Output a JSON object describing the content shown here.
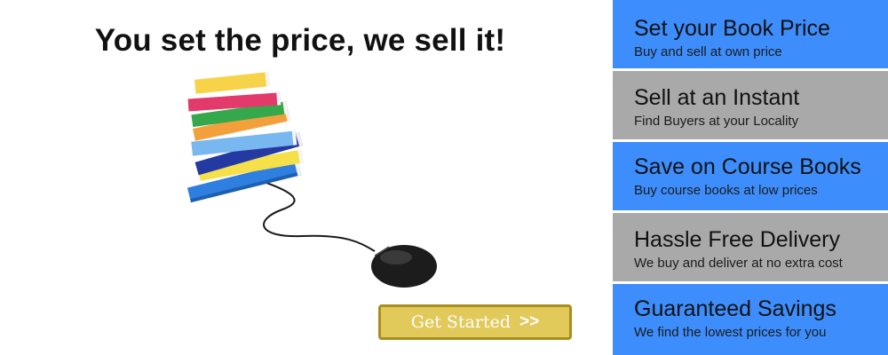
{
  "hero": {
    "headline": "You set the price, we sell it!",
    "cta_label": "Get Started",
    "cta_arrows": ">>"
  },
  "colors": {
    "feature_blue": "#3d8efc",
    "feature_gray": "#a9a9a9",
    "cta_gold": "#e1c95a",
    "cta_border": "#a88e21"
  },
  "features": [
    {
      "title": "Set your Book Price",
      "subtitle": "Buy and sell at own price",
      "color": "#3d8efc"
    },
    {
      "title": "Sell at an Instant",
      "subtitle": "Find Buyers at your Locality",
      "color": "#a9a9a9"
    },
    {
      "title": "Save on Course Books",
      "subtitle": "Buy course books at low prices",
      "color": "#3d8efc"
    },
    {
      "title": "Hassle Free Delivery",
      "subtitle": "We buy and deliver at no extra cost",
      "color": "#a9a9a9"
    },
    {
      "title": "Guaranteed Savings",
      "subtitle": "We find the lowest prices for you",
      "color": "#3d8efc"
    }
  ]
}
